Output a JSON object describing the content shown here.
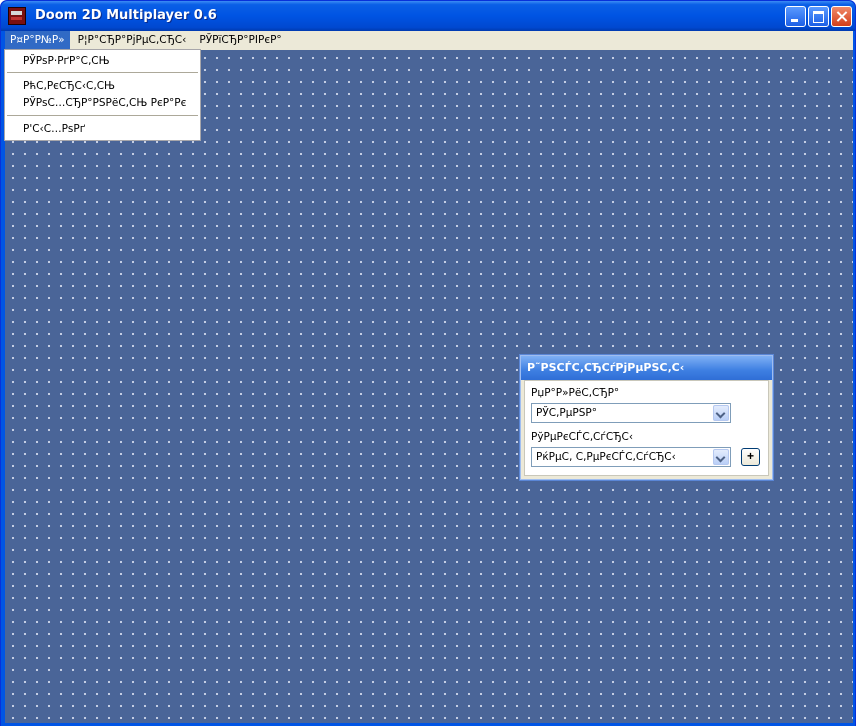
{
  "window": {
    "title": "Doom 2D Multiplayer 0.6"
  },
  "menubar": {
    "items": [
      {
        "label": "Р¤Р°Р№Р»"
      },
      {
        "label": "Р¦Р°СЂР°РјРµС‚СЂС‹"
      },
      {
        "label": "РЎРїСЂР°РІРєР°"
      }
    ]
  },
  "file_menu": {
    "items": [
      {
        "label": "РЎРѕР·РґР°С‚СЊ"
      },
      {
        "label": "РћС‚РєСЂС‹С‚СЊ"
      },
      {
        "label": "РЎРѕС…СЂР°РЅРёС‚СЊ РєР°Рє"
      },
      {
        "label": "Р'С‹С…РѕРґ"
      }
    ]
  },
  "tools_panel": {
    "title": "Р˜РЅСЃС‚СЂСѓРјРµРЅС‚С‹",
    "palette_label": "РџР°Р»РёС‚СЂР°",
    "palette_value": "РЎС‚РµРЅР°",
    "textures_label": "РўРµРєСЃС‚СѓСЂС‹",
    "textures_value": "РќРµС‚ С‚РµРєСЃС‚СѓСЂС‹",
    "add_label": "+"
  },
  "colors": {
    "titlebar": "#0054e3",
    "client_bg": "#4a6598",
    "grid_dot": "#d6def0",
    "menu_highlight": "#316ac5"
  }
}
